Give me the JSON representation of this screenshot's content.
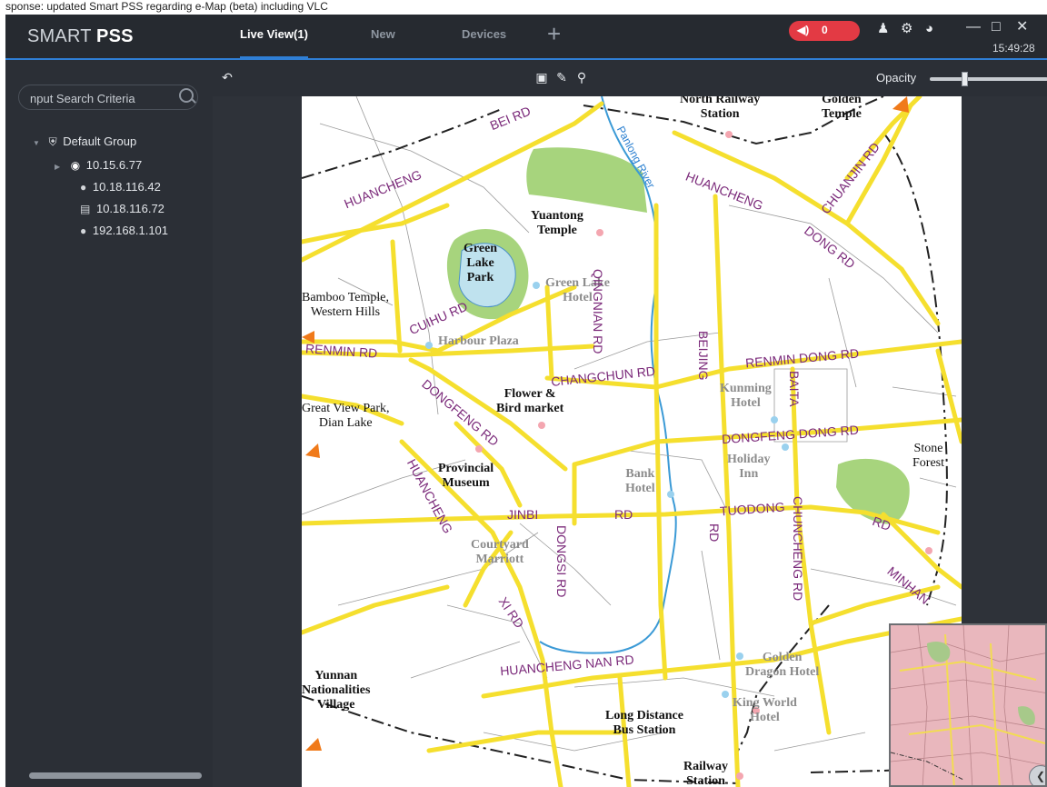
{
  "doc_strip": "sponse: updated Smart PSS regarding e-Map (beta) including VLC",
  "brand": {
    "light": "SMART ",
    "bold": "PSS"
  },
  "tabs": [
    {
      "label": "Live View(1)",
      "active": true
    },
    {
      "label": "New",
      "active": false
    },
    {
      "label": "Devices",
      "active": false
    }
  ],
  "alarm_count": "0",
  "clock": "15:49:28",
  "search": {
    "placeholder": "nput Search Criteria"
  },
  "tree": {
    "group": "Default Group",
    "devices": [
      {
        "ip": "10.15.6.77",
        "icon": "camera-pin-icon"
      },
      {
        "ip": "10.18.116.42",
        "icon": "offline-camera-icon"
      },
      {
        "ip": "10.18.116.72",
        "icon": "nvr-icon"
      },
      {
        "ip": "192.168.1.101",
        "icon": "offline-camera-icon"
      }
    ]
  },
  "toolbar": {
    "opacity_label": "Opacity",
    "opacity_level": 0.3
  },
  "map": {
    "places": {
      "north_railway": "North Railway",
      "station": "Station",
      "golden_temple_1": "Golden",
      "golden_temple_2": "Temple",
      "yuantong_1": "Yuantong",
      "yuantong_2": "Temple",
      "greenlake_1": "Green",
      "greenlake_2": "Lake",
      "greenlake_3": "Park",
      "greenlake_hotel_1": "Green Lake",
      "greenlake_hotel_2": "Hotel",
      "bamboo_1": "Bamboo Temple,",
      "bamboo_2": "Western Hills",
      "harbour": "Harbour Plaza",
      "flower_1": "Flower &",
      "flower_2": "Bird market",
      "greatview_1": "Great View Park,",
      "greatview_2": "Dian Lake",
      "kunming_1": "Kunming",
      "kunming_2": "Hotel",
      "holiday_1": "Holiday",
      "holiday_2": "Inn",
      "stone_1": "Stone",
      "stone_2": "Forest",
      "museum_1": "Provincial",
      "museum_2": "Museum",
      "bank_1": "Bank",
      "bank_2": "Hotel",
      "courtyard_1": "Courtyard",
      "courtyard_2": "Marriott",
      "golden_dragon_1": "Golden",
      "golden_dragon_2": "Dragon Hotel",
      "kingworld_1": "King World",
      "kingworld_2": "Hotel",
      "yunnan_1": "Yunnan",
      "yunnan_2": "Nationalities",
      "yunnan_3": "Village",
      "longdist_1": "Long Distance",
      "longdist_2": "Bus Station",
      "railway_1": "Railway",
      "railway_2": "Station"
    },
    "roads": {
      "bei": "BEI",
      "rd": "RD",
      "huancheng": "HUANCHENG",
      "huancheng_dong": "DONG",
      "chuanjin": "CHUANJIN RD",
      "qingnian": "QINGNIAN",
      "cuihu": "CUIHU",
      "renmin": "RENMIN RD",
      "renmin_dong": "RENMIN DONG RD",
      "changchun": "CHANGCHUN RD",
      "beijing": "BEIJING",
      "baita": "BAITA",
      "dongfeng": "DONGFENG",
      "dongfeng_dong": "DONGFENG DONG RD",
      "jinbi": "JINBI",
      "tuodong": "TUODONG",
      "dongsi": "DONGSI RD",
      "xi": "XI",
      "chuncheng": "CHUNCHENG",
      "minhan": "MINHAN",
      "huancheng_nan": "HUANCHENG NAN RD"
    },
    "river": "Panlong River"
  }
}
